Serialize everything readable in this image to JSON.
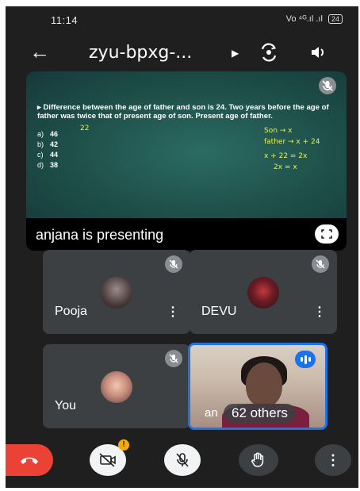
{
  "status": {
    "time": "11:14",
    "signal_text": "Vo ⁴ᴳ.ıl .ıl",
    "battery": "24"
  },
  "header": {
    "title": "zyu-bpxg-...",
    "back": "←"
  },
  "presentation": {
    "question": "▸ Difference between the age of father and son is 24. Two years before the age of father was twice that of present age of son. Present age of father.",
    "options": [
      {
        "key": "a)",
        "value": "46"
      },
      {
        "key": "b)",
        "value": "42"
      },
      {
        "key": "c)",
        "value": "44"
      },
      {
        "key": "d)",
        "value": "38"
      }
    ],
    "handwriting": {
      "note1": "22",
      "note2": "Son → x",
      "note3": "father → x + 24",
      "note4": "x + 22 = 2x",
      "note5": "2x = x"
    },
    "presenter_label": "anjana is presenting"
  },
  "participants": [
    {
      "name": "Pooja",
      "more": "⋮"
    },
    {
      "name": "DEVU",
      "more": "⋮"
    },
    {
      "name": "You"
    },
    {
      "name": "an",
      "others_label": "62 others"
    }
  ],
  "colors": {
    "end_call": "#ea4335",
    "accent": "#1a73e8",
    "tile_bg": "#3c4043",
    "badge": "#f9ab00"
  },
  "controls": {
    "cam_badge": "!",
    "more": "⋮"
  }
}
